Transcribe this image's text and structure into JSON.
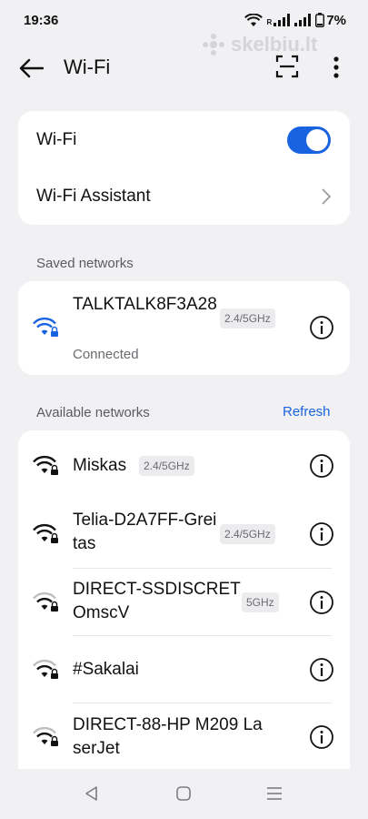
{
  "status_bar": {
    "time": "19:36",
    "signal_marker": "R",
    "battery_percent": "7%"
  },
  "watermark": {
    "text": "skelbiu.lt"
  },
  "header": {
    "title": "Wi-Fi",
    "icons": [
      "back-arrow-icon",
      "qr-scan-icon",
      "more-vertical-icon"
    ]
  },
  "wifi_card": {
    "wifi_label": "Wi-Fi",
    "wifi_enabled": true,
    "assistant_label": "Wi-Fi Assistant"
  },
  "saved_section": {
    "label": "Saved networks",
    "networks": [
      {
        "name": "TALKTALK8F3A28",
        "status": "Connected",
        "band": "2.4/5GHz",
        "signal": 3
      }
    ]
  },
  "available_section": {
    "label": "Available networks",
    "refresh_label": "Refresh",
    "networks": [
      {
        "name": "Miskas",
        "band": "2.4/5GHz",
        "signal": 3
      },
      {
        "name": "Telia-D2A7FF-Greitas",
        "band": "2.4/5GHz",
        "signal": 3
      },
      {
        "name": "DIRECT-SSDISCRETOmscV",
        "band": "5GHz",
        "signal": 2
      },
      {
        "name": "#Sakalai",
        "band": "",
        "signal": 2
      },
      {
        "name": "DIRECT-88-HP M209 LaserJet",
        "band": "",
        "signal": 2
      }
    ]
  },
  "colors": {
    "accent": "#1a63e0",
    "background": "#f1f1f3",
    "card": "#ffffff"
  }
}
